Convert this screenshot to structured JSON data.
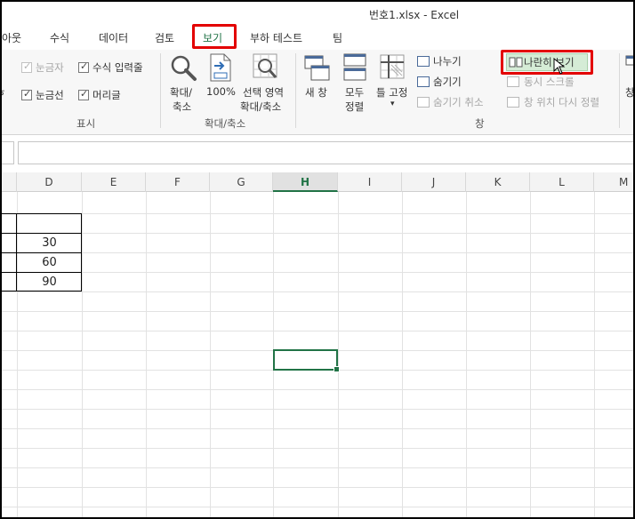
{
  "window": {
    "title": "번호1.xlsx - Excel"
  },
  "tabs": [
    {
      "label": "아웃"
    },
    {
      "label": "수식"
    },
    {
      "label": "데이터"
    },
    {
      "label": "검토"
    },
    {
      "label": "보기",
      "active": true
    },
    {
      "label": "부하 테스트"
    },
    {
      "label": "팀"
    }
  ],
  "ribbon": {
    "show_group": {
      "label": "표시",
      "items": [
        {
          "label": "눈금자",
          "checked": true,
          "disabled": true
        },
        {
          "label": "수식 입력줄",
          "checked": true,
          "disabled": false
        },
        {
          "label": "눈금선",
          "checked": true,
          "disabled": false
        },
        {
          "label": "머리글",
          "checked": true,
          "disabled": false
        }
      ]
    },
    "zoom_group": {
      "label": "확대/축소",
      "zoom": {
        "label_line1": "확대/",
        "label_line2": "축소",
        "icon": "magnifier-icon"
      },
      "zoom100": {
        "label": "100%",
        "icon": "zoom-100-icon"
      },
      "zoom_selection": {
        "label_line1": "선택 영역",
        "label_line2": "확대/축소",
        "icon": "zoom-selection-icon"
      }
    },
    "window_group": {
      "label": "창",
      "new_window": {
        "label": "새 창",
        "icon": "new-window-icon"
      },
      "arrange_all": {
        "label_line1": "모두",
        "label_line2": "정렬",
        "icon": "arrange-all-icon"
      },
      "freeze_panes": {
        "label": "틀 고정",
        "icon": "freeze-panes-icon",
        "dropdown": "▾"
      },
      "split": {
        "label": "나누기"
      },
      "hide": {
        "label": "숨기기"
      },
      "unhide": {
        "label": "숨기기 취소",
        "disabled": true
      },
      "view_side_by_side": {
        "label": "나란히 보기"
      },
      "sync_scroll": {
        "label": "동시 스크롤",
        "disabled": true
      },
      "reset_position": {
        "label": "창 위치 다시 정렬",
        "disabled": true
      },
      "switch_windows_partial": {
        "label": "창"
      }
    }
  },
  "sheet": {
    "columns": [
      "D",
      "E",
      "F",
      "G",
      "H",
      "I",
      "J",
      "K",
      "L",
      "M"
    ],
    "selected_column": "H",
    "cells_D": [
      "",
      "30",
      "60",
      "90"
    ],
    "accent_color": "#217346",
    "highlight_color": "#e30000"
  }
}
